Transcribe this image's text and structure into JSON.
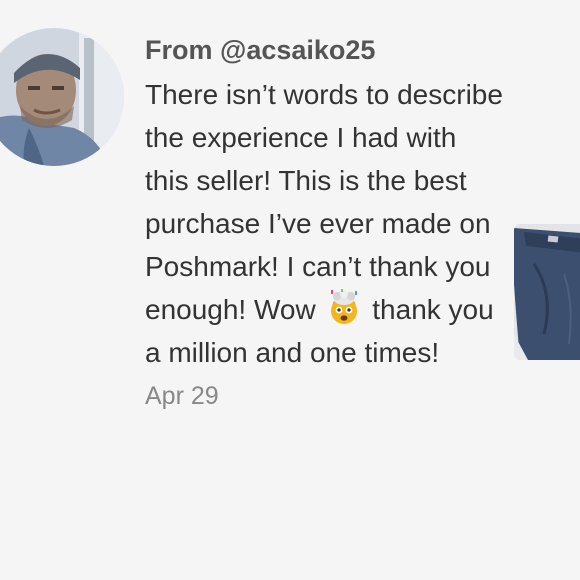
{
  "review": {
    "from_label": "From @acsaiko25",
    "text_before_emoji": "There isn’t words to describe the experience I had with this seller! This is the best purchase I’ve ever made on Poshmark! I can’t thank you enough! Wow",
    "emoji_icon": "exploding-head-emoji",
    "text_after_emoji": "thank you a million and one times!",
    "date": "Apr 29"
  },
  "avatar": {
    "icon": "user-photo-avatar"
  },
  "listing_thumbnail": {
    "icon": "navy-pants-photo"
  },
  "colors": {
    "background": "#f5f5f5",
    "username_text": "#555555",
    "body_text": "#333333",
    "date_text": "#888888"
  }
}
